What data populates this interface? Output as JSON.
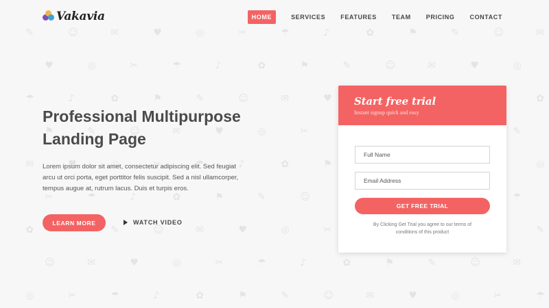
{
  "brand": {
    "name": "Vakavia",
    "logo_colors": [
      "#7e4fb5",
      "#3fa0d8",
      "#f1b64a"
    ]
  },
  "nav": {
    "items": [
      {
        "label": "HOME",
        "active": true
      },
      {
        "label": "SERVICES"
      },
      {
        "label": "FEATURES"
      },
      {
        "label": "TEAM"
      },
      {
        "label": "PRICING"
      },
      {
        "label": "CONTACT"
      }
    ]
  },
  "hero": {
    "title_line1": "Professional Multipurpose",
    "title_line2": "Landing Page",
    "text": "Lorem ipsum dolor sit amet, consectetur adipiscing elit. Sed feugiat arcu ut orci porta, eget porttitor felis suscipit. Sed a nisl ullamcorper, tempus augue at, rutrum lacus. Duis et turpis eros.",
    "learn_more": "LEARN MORE",
    "watch_video": "WATCH VIDEO"
  },
  "trial": {
    "title": "Start free trial",
    "subtitle": "Instant signup quick and easy",
    "name_placeholder": "Full Name",
    "email_placeholder": "Email Address",
    "button": "GET FREE TRIAL",
    "terms": "By Clicking Get Trial you agree to our terms of conditions of this product"
  },
  "colors": {
    "accent": "#f46363",
    "background": "#f7f7f8",
    "text": "#4a4a4a"
  },
  "icons": [
    "play-icon",
    "logo-mark-icon"
  ]
}
